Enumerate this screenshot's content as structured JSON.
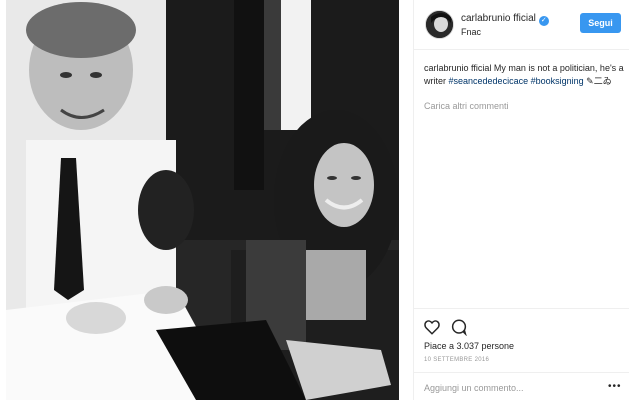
{
  "post": {
    "username": "carlabrunio fficial",
    "location": "Fnac",
    "follow_label": "Segui",
    "verified_icon": "checkmark-icon"
  },
  "caption": {
    "author": "carlabrunio fficial",
    "text": "My man is not a politician, he's a writer",
    "hashtag1": "#seancededecicace",
    "hashtag2": "#booksigning",
    "emoji": "✎二ゐ"
  },
  "comments": {
    "load_more": "Carica altri commenti"
  },
  "actions": {
    "like_icon": "heart-icon",
    "comment_icon": "comment-icon",
    "likes": "Piace a 3.037 persone",
    "date": "10 settembre 2016"
  },
  "comment_box": {
    "placeholder": "Aggiungi un commento...",
    "more": "•••"
  },
  "colors": {
    "accent": "#3897f0",
    "hashtag": "#003569",
    "muted": "#999999"
  }
}
